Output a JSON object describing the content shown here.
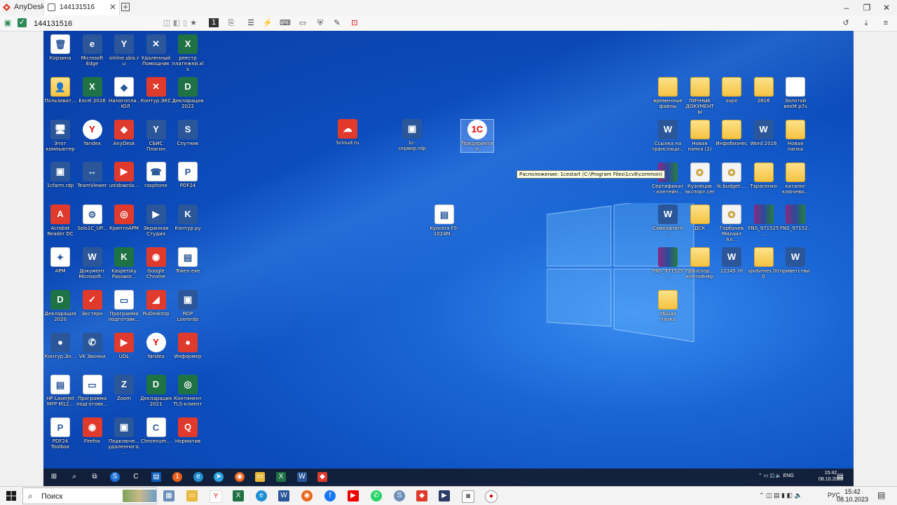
{
  "app": {
    "name": "AnyDesk",
    "tab_label": "144131516",
    "address": "144131516"
  },
  "desktop": {
    "left_icons": [
      {
        "label": "Корзина",
        "icon": "recycle-bin-icon",
        "glyph": "🗑",
        "cls": "doc"
      },
      {
        "label": "Microsoft Edge",
        "icon": "edge-icon",
        "glyph": "e",
        "cls": "word"
      },
      {
        "label": "online.sbis.ru",
        "icon": "sbis-icon",
        "glyph": "Y",
        "cls": "word"
      },
      {
        "label": "Удаленный Помощник",
        "icon": "remote-helper-icon",
        "glyph": "✕",
        "cls": "word"
      },
      {
        "label": "реестр платежей.xls",
        "icon": "excel-file-icon",
        "glyph": "X",
        "cls": "excel"
      },
      {
        "label": "Пользоват...",
        "icon": "user-folder-icon",
        "glyph": "👤",
        "cls": "folder"
      },
      {
        "label": "Excel 2016",
        "icon": "excel-icon",
        "glyph": "X",
        "cls": "excel"
      },
      {
        "label": "Налогопла... ЮЛ",
        "icon": "tax-icon",
        "glyph": "◆",
        "cls": "doc"
      },
      {
        "label": "Контур.ЭКС",
        "icon": "kontur-icon",
        "glyph": "✕",
        "cls": "red"
      },
      {
        "label": "Декларация 2022",
        "icon": "declaration-icon",
        "glyph": "D",
        "cls": "excel"
      },
      {
        "label": "Этот компьютер",
        "icon": "computer-icon",
        "glyph": "🖥",
        "cls": "word"
      },
      {
        "label": "Yandex",
        "icon": "yandex-icon",
        "glyph": "Y",
        "cls": "yandex"
      },
      {
        "label": "AnyDesk",
        "icon": "anydesk-icon",
        "glyph": "◆",
        "cls": "red"
      },
      {
        "label": "СБИС Плагин",
        "icon": "sbis-plugin-icon",
        "glyph": "Y",
        "cls": "word"
      },
      {
        "label": "Спутник",
        "icon": "sputnik-icon",
        "glyph": "S",
        "cls": "word"
      },
      {
        "label": "1cfarm.rdp",
        "icon": "rdp-icon",
        "glyph": "▣",
        "cls": "word"
      },
      {
        "label": "TeamViewer",
        "icon": "teamviewer-icon",
        "glyph": "↔",
        "cls": "word"
      },
      {
        "label": "unidownlo...",
        "icon": "unidownload-icon",
        "glyph": "▶",
        "cls": "red"
      },
      {
        "label": "rasphone",
        "icon": "rasphone-icon",
        "glyph": "☎",
        "cls": "doc"
      },
      {
        "label": "PDF24",
        "icon": "pdf24-icon",
        "glyph": "P",
        "cls": "doc"
      },
      {
        "label": "Acrobat Reader DC",
        "icon": "acrobat-icon",
        "glyph": "A",
        "cls": "red"
      },
      {
        "label": "Sols1C_UP...",
        "icon": "gear-file-icon",
        "glyph": "⚙",
        "cls": "doc"
      },
      {
        "label": "КриптоАРМ",
        "icon": "cryptoarm-icon",
        "glyph": "◎",
        "cls": "red"
      },
      {
        "label": "Экранная Студия",
        "icon": "screen-studio-icon",
        "glyph": "▶",
        "cls": "word"
      },
      {
        "label": "Контур.ру",
        "icon": "kontur-ru-icon",
        "glyph": "K",
        "cls": "word"
      },
      {
        "label": "АРМ",
        "icon": "arm-icon",
        "glyph": "✦",
        "cls": "doc"
      },
      {
        "label": "Документ Microsoft...",
        "icon": "word-doc-icon",
        "glyph": "W",
        "cls": "word"
      },
      {
        "label": "Kaspersky Passwor...",
        "icon": "kaspersky-icon",
        "glyph": "K",
        "cls": "excel"
      },
      {
        "label": "Google Chrome",
        "icon": "chrome-icon",
        "glyph": "◉",
        "cls": "red"
      },
      {
        "label": "Token.exe",
        "icon": "token-icon",
        "glyph": "▤",
        "cls": "doc"
      },
      {
        "label": "Декларация 2020",
        "icon": "declaration-2020-icon",
        "glyph": "D",
        "cls": "excel"
      },
      {
        "label": "Экстерн",
        "icon": "extern-icon",
        "glyph": "✓",
        "cls": "red"
      },
      {
        "label": "Программа подготовк...",
        "icon": "program-icon",
        "glyph": "▭",
        "cls": "doc"
      },
      {
        "label": "RuDesktop",
        "icon": "rudesktop-icon",
        "glyph": "◢",
        "cls": "red"
      },
      {
        "label": "RDP Loomrdp",
        "icon": "rdp-loom-icon",
        "glyph": "▣",
        "cls": "word"
      },
      {
        "label": "Контур.Эл...",
        "icon": "kontur-el-icon",
        "glyph": "●",
        "cls": "word"
      },
      {
        "label": "VK Звонки",
        "icon": "vk-calls-icon",
        "glyph": "✆",
        "cls": "word"
      },
      {
        "label": "UDL",
        "icon": "udl-icon",
        "glyph": "▶",
        "cls": "red"
      },
      {
        "label": "Yandex",
        "icon": "yandex-2-icon",
        "glyph": "Y",
        "cls": "yandex"
      },
      {
        "label": "Информер",
        "icon": "informer-icon",
        "glyph": "●",
        "cls": "red"
      },
      {
        "label": "HP LaserJet MFP M12...",
        "icon": "printer-icon",
        "glyph": "▤",
        "cls": "doc"
      },
      {
        "label": "Программа подготовк...",
        "icon": "program-2-icon",
        "glyph": "▭",
        "cls": "doc"
      },
      {
        "label": "Zoom",
        "icon": "zoom-icon",
        "glyph": "Z",
        "cls": "word"
      },
      {
        "label": "Декларация 2021",
        "icon": "declaration-2021-icon",
        "glyph": "D",
        "cls": "excel"
      },
      {
        "label": "Континент TLS-клиент",
        "icon": "continent-icon",
        "glyph": "◎",
        "cls": "excel"
      },
      {
        "label": "PDF24 Toolbox",
        "icon": "pdf24-toolbox-icon",
        "glyph": "P",
        "cls": "doc"
      },
      {
        "label": "Firefox",
        "icon": "firefox-icon",
        "glyph": "◉",
        "cls": "red"
      },
      {
        "label": "Подключе... удаленного...",
        "icon": "rdp-connect-icon",
        "glyph": "▣",
        "cls": "word"
      },
      {
        "label": "Chromium...",
        "icon": "chromium-icon",
        "glyph": "C",
        "cls": "doc"
      },
      {
        "label": "Норматив",
        "icon": "normativ-icon",
        "glyph": "Q",
        "cls": "red"
      }
    ],
    "middle_icons": [
      {
        "label": "Scloud.ru",
        "icon": "scloud-icon",
        "glyph": "☁",
        "cls": "red"
      },
      {
        "label": "1с-сервер.rdp",
        "icon": "server-rdp-icon",
        "glyph": "▣",
        "cls": "word"
      },
      {
        "label": "Предприятие",
        "icon": "1c-icon",
        "glyph": "1С",
        "cls": "yandex"
      },
      {
        "label": "Kyocera FS-1024M...",
        "icon": "kyocera-printer-icon",
        "glyph": "▤",
        "cls": "doc"
      }
    ],
    "right_icons": [
      {
        "label": "временные файлы",
        "icon": "folder-icon",
        "glyph": "",
        "cls": "folder"
      },
      {
        "label": "ЛИЧНЫЕ ДОКУМЕНТЫ",
        "icon": "folder-icon",
        "glyph": "",
        "cls": "folder"
      },
      {
        "label": "ovpn",
        "icon": "folder-icon",
        "glyph": "",
        "cls": "folder"
      },
      {
        "label": "2816",
        "icon": "folder-icon",
        "glyph": "",
        "cls": "folder"
      },
      {
        "label": "Золотой векМ.p7s",
        "icon": "file-icon",
        "glyph": "",
        "cls": "doc"
      },
      {
        "label": "Ссылка на трансляци...",
        "icon": "word-doc-icon",
        "glyph": "W",
        "cls": "word"
      },
      {
        "label": "Новая папка (2)",
        "icon": "folder-icon",
        "glyph": "",
        "cls": "folder"
      },
      {
        "label": "Инфобизнес",
        "icon": "folder-icon",
        "glyph": "",
        "cls": "folder"
      },
      {
        "label": "Word 2016",
        "icon": "word-icon",
        "glyph": "W",
        "cls": "word"
      },
      {
        "label": "Новая папка",
        "icon": "folder-icon",
        "glyph": "",
        "cls": "folder"
      },
      {
        "label": "Сертификат - контейн...",
        "icon": "rar-icon",
        "glyph": "",
        "cls": "rar"
      },
      {
        "label": "Кузнецов экспорт.cer",
        "icon": "certificate-icon",
        "glyph": "✪",
        "cls": "cert"
      },
      {
        "label": "lk.budget....",
        "icon": "certificate-icon",
        "glyph": "✪",
        "cls": "cert"
      },
      {
        "label": "Тарасенко",
        "icon": "folder-icon",
        "glyph": "",
        "cls": "folder"
      },
      {
        "label": "каталог ключево...",
        "icon": "folder-icon",
        "glyph": "",
        "cls": "folder"
      },
      {
        "label": "Самозаняте...",
        "icon": "word-doc-icon",
        "glyph": "W",
        "cls": "word"
      },
      {
        "label": "ДСК",
        "icon": "folder-icon",
        "glyph": "",
        "cls": "folder"
      },
      {
        "label": "Горбачев Михаил Ал...",
        "icon": "certificate-icon",
        "glyph": "✪",
        "cls": "cert"
      },
      {
        "label": "FNS_971525...",
        "icon": "rar-icon",
        "glyph": "",
        "cls": "rar"
      },
      {
        "label": "FNS_97152...",
        "icon": "rar-icon",
        "glyph": "",
        "cls": "rar"
      },
      {
        "label": "FNS_971525...",
        "icon": "rar-icon",
        "glyph": "",
        "cls": "rar"
      },
      {
        "label": "транспор... контейнер",
        "icon": "folder-icon",
        "glyph": "",
        "cls": "folder"
      },
      {
        "label": "12345.rtf",
        "icon": "word-doc-icon",
        "glyph": "W",
        "cls": "word"
      },
      {
        "label": "ajxdvmes.000",
        "icon": "folder-icon",
        "glyph": "",
        "cls": "folder"
      },
      {
        "label": "приветстви...",
        "icon": "word-doc-icon",
        "glyph": "W",
        "cls": "word"
      },
      {
        "label": "общая папка",
        "icon": "folder-icon",
        "glyph": "",
        "cls": "folder"
      }
    ],
    "tooltip": "Расположение: 1cestart (C:\\Program Files\\1cv8\\common)"
  },
  "remote_taskbar": {
    "lang": "ENG",
    "time": "15:42",
    "date": "08.10.2023"
  },
  "local_taskbar": {
    "search_label": "Поиск",
    "lang": "РУС",
    "time": "15:42",
    "date": "08.10.2023"
  }
}
